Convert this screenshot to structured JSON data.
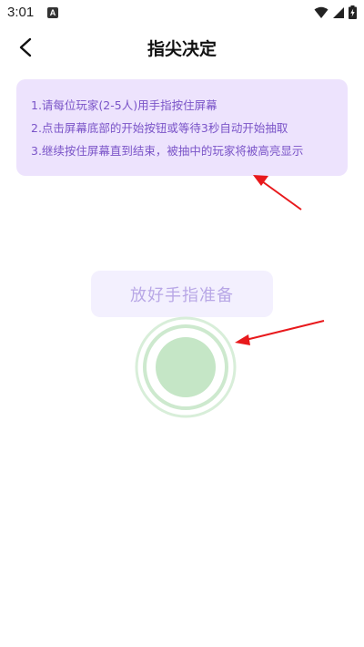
{
  "status_bar": {
    "time": "3:01",
    "notification_icon": "a-badge-icon",
    "icons": [
      "wifi-icon",
      "signal-icon",
      "battery-charging-icon"
    ]
  },
  "header": {
    "back_icon": "chevron-left-icon",
    "title": "指尖决定"
  },
  "instructions": {
    "lines": [
      "1.请每位玩家(2-5人)用手指按住屏幕",
      "2.点击屏幕底部的开始按钮或等待3秒自动开始抽取",
      "3.继续按住屏幕直到结束，被抽中的玩家将被高亮显示"
    ]
  },
  "ready_label": "放好手指准备",
  "touch_circle": {
    "icon": "finger-touch-circle",
    "color": "#c5e6c6",
    "ring_color": "#d8eed9"
  },
  "annotation_color": "#e8191c",
  "colors": {
    "instruction_bg": "#ede3fd",
    "instruction_text": "#7a54c8",
    "ready_bg": "#f3f0fe",
    "ready_text": "#b8a7e6"
  }
}
